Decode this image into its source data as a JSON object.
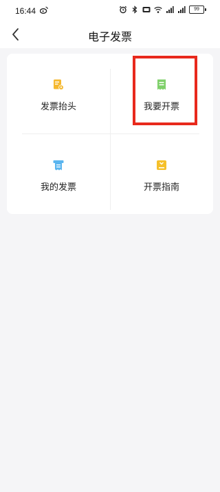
{
  "status_bar": {
    "time": "16:44",
    "battery": "99"
  },
  "header": {
    "title": "电子发票"
  },
  "grid": {
    "items": [
      {
        "label": "发票抬头",
        "icon": "invoice-title-icon",
        "color": "#f5b82e"
      },
      {
        "label": "我要开票",
        "icon": "issue-invoice-icon",
        "color": "#7fd06a"
      },
      {
        "label": "我的发票",
        "icon": "my-invoices-icon",
        "color": "#5bb5ef"
      },
      {
        "label": "开票指南",
        "icon": "invoice-guide-icon",
        "color": "#f5c02a"
      }
    ]
  },
  "colors": {
    "highlight": "#e8291c",
    "page_background": "#f5f5f7"
  }
}
